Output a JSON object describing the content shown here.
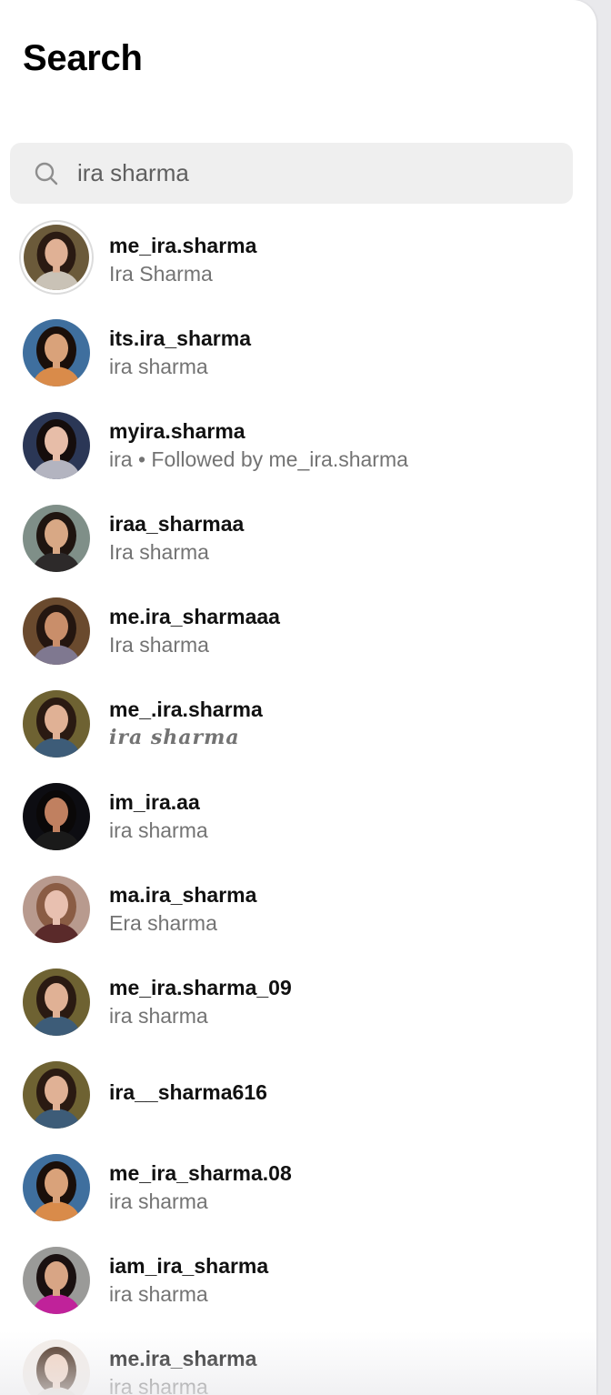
{
  "page": {
    "title": "Search"
  },
  "search": {
    "value": "ira sharma",
    "icon": "search-icon"
  },
  "results": [
    {
      "username": "me_ira.sharma",
      "name": "Ira Sharma",
      "story_ring": true,
      "bg": "#6b5a3a",
      "hair": "#2a1a12",
      "skin": "#e0b195",
      "shirt": "#c9c2b6"
    },
    {
      "username": "its.ira_sharma",
      "name": "ira sharma",
      "bg": "#3f6f9e",
      "hair": "#1a0f0a",
      "skin": "#d9a27a",
      "shirt": "#d98b4a"
    },
    {
      "username": "myira.sharma",
      "name": "ira • Followed by me_ira.sharma",
      "bg": "#2b3756",
      "hair": "#150d0c",
      "skin": "#e7bda8",
      "shirt": "#b3b4c0"
    },
    {
      "username": "iraa_sharmaa",
      "name": "Ira sharma",
      "bg": "#7f8f88",
      "hair": "#1f1510",
      "skin": "#d8a885",
      "shirt": "#2d2a2a"
    },
    {
      "username": "me.ira_sharmaaa",
      "name": "Ira sharma",
      "bg": "#6a4a2e",
      "hair": "#241610",
      "skin": "#c98e6a",
      "shirt": "#7f7890"
    },
    {
      "username": "me_.ira.sharma",
      "name": "𝒊𝒓𝒂 𝒔𝒉𝒂𝒓𝒎𝒂",
      "script": true,
      "bg": "#6e6232",
      "hair": "#2a1a12",
      "skin": "#e0b195",
      "shirt": "#3d5c78"
    },
    {
      "username": "im_ira.aa",
      "name": "ira sharma",
      "bg": "#0d0d12",
      "hair": "#0a0808",
      "skin": "#c08060",
      "shirt": "#1a1a1a"
    },
    {
      "username": "ma.ira_sharma",
      "name": "Era sharma",
      "bg": "#b89a8e",
      "hair": "#8a5c44",
      "skin": "#e8c0b0",
      "shirt": "#5a2a2a"
    },
    {
      "username": "me_ira.sharma_09",
      "name": "ira sharma",
      "bg": "#6e6232",
      "hair": "#2a1a12",
      "skin": "#e0b195",
      "shirt": "#3d5c78"
    },
    {
      "username": "ira__sharma616",
      "name": "",
      "bg": "#6e6232",
      "hair": "#2a1a12",
      "skin": "#e0b195",
      "shirt": "#3d5c78"
    },
    {
      "username": "me_ira_sharma.08",
      "name": "ira sharma",
      "bg": "#3f6f9e",
      "hair": "#1a0f0a",
      "skin": "#d9a27a",
      "shirt": "#d98b4a"
    },
    {
      "username": "iam_ira_sharma",
      "name": "ira sharma",
      "bg": "#9a9a98",
      "hair": "#1a1010",
      "skin": "#d8a585",
      "shirt": "#c0229a"
    },
    {
      "username": "me.ira_sharma",
      "name": "ira sharma",
      "bg": "#f3ede8",
      "hair": "#4a3020",
      "skin": "#f1d2c0",
      "shirt": "#e8e0d8"
    }
  ]
}
